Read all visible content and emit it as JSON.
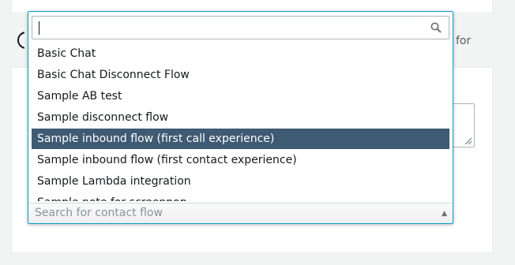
{
  "background": {
    "side_label": "for"
  },
  "dropdown": {
    "search": {
      "value": "",
      "icon": "search-icon"
    },
    "options": [
      {
        "label": "Basic Chat",
        "selected": false
      },
      {
        "label": "Basic Chat Disconnect Flow",
        "selected": false
      },
      {
        "label": "Sample AB test",
        "selected": false
      },
      {
        "label": "Sample disconnect flow",
        "selected": false
      },
      {
        "label": "Sample inbound flow (first call experience)",
        "selected": true
      },
      {
        "label": "Sample inbound flow (first contact experience)",
        "selected": false
      },
      {
        "label": "Sample Lambda integration",
        "selected": false
      },
      {
        "label": "Sample note for screenpop",
        "selected": false
      }
    ],
    "footer": {
      "placeholder": "Search for contact flow",
      "arrow_icon": "triangle-up-icon"
    }
  },
  "colors": {
    "accent": "#00a1c9",
    "selected_bg": "#3f5a73"
  }
}
